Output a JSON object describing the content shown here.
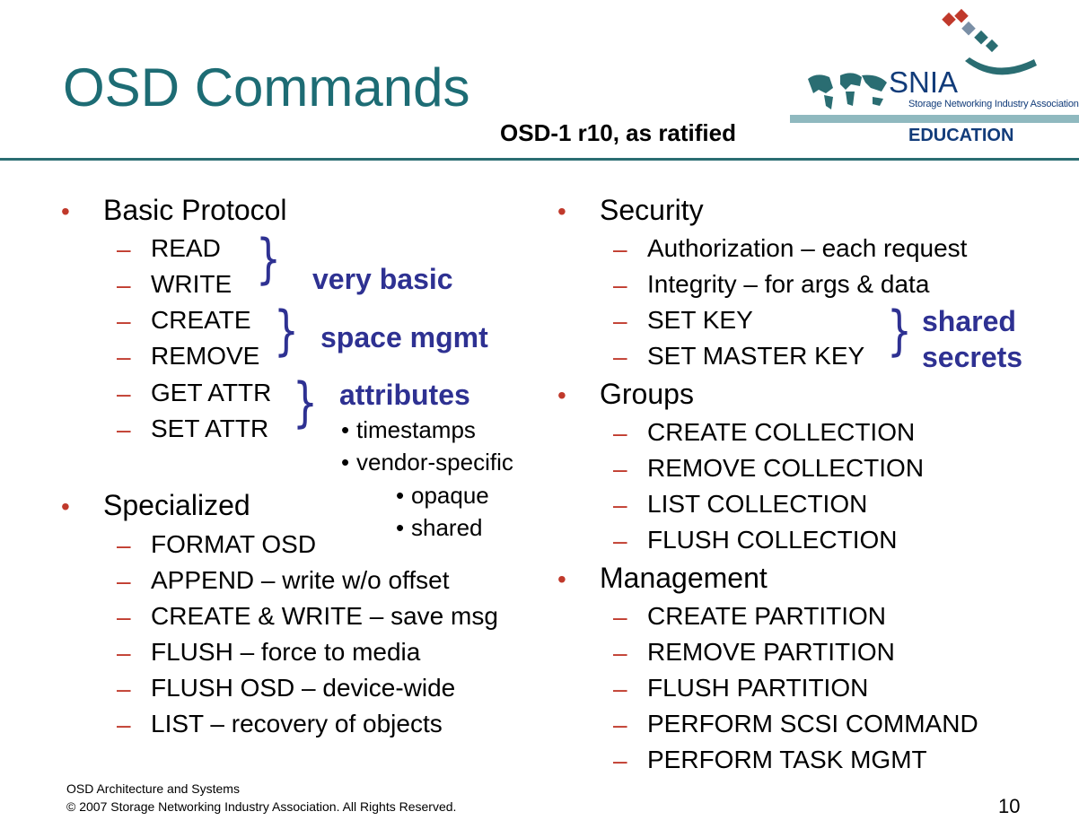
{
  "slide": {
    "title": "OSD Commands",
    "subtitle": "OSD-1 r10, as ratified",
    "brand": {
      "name": "SNIA",
      "subname": "Storage Networking Industry Association",
      "section": "EDUCATION"
    },
    "glyphs": {
      "bullet": "•",
      "dash": "–",
      "brace": "}",
      "small_bullet": "•"
    },
    "left": {
      "basic": {
        "heading": "Basic Protocol",
        "items": [
          "READ",
          "WRITE",
          "CREATE",
          "REMOVE",
          "GET ATTR",
          "SET ATTR"
        ]
      },
      "notes": {
        "very_basic": "very basic",
        "space_mgmt": "space mgmt",
        "attributes": "attributes",
        "timestamps": "timestamps",
        "vendor_specific": "vendor-specific",
        "opaque": "opaque",
        "shared": "shared"
      },
      "specialized": {
        "heading": "Specialized",
        "items": [
          "FORMAT OSD",
          "APPEND – write w/o offset",
          "CREATE & WRITE – save msg",
          "FLUSH – force to media",
          "FLUSH OSD – device-wide",
          "LIST – recovery of objects"
        ]
      }
    },
    "right": {
      "security": {
        "heading": "Security",
        "items": [
          "Authorization – each request",
          "Integrity – for args & data",
          "SET KEY",
          "SET MASTER KEY"
        ],
        "note_line1": "shared",
        "note_line2": "secrets"
      },
      "groups": {
        "heading": "Groups",
        "items": [
          "CREATE COLLECTION",
          "REMOVE COLLECTION",
          "LIST COLLECTION",
          "FLUSH COLLECTION"
        ]
      },
      "management": {
        "heading": "Management",
        "items": [
          "CREATE PARTITION",
          "REMOVE PARTITION",
          "FLUSH PARTITION",
          "PERFORM SCSI COMMAND",
          "PERFORM TASK MGMT"
        ]
      }
    },
    "footer": {
      "line1": "OSD Architecture and Systems",
      "line2": "© 2007 Storage Networking Industry Association. All Rights Reserved.",
      "page_number": "10"
    },
    "colors": {
      "title": "#1d6c74",
      "accent": "#c0392b",
      "note": "#2e3192",
      "brand": "#123c7a"
    }
  }
}
